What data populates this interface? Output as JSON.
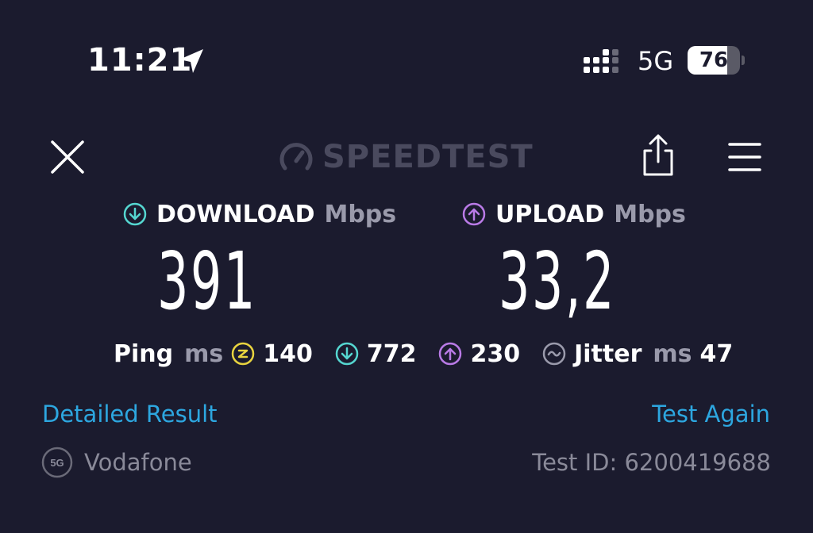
{
  "status_bar": {
    "time": "11:21",
    "network": "5G",
    "battery": {
      "level_text": "76",
      "fraction": 0.76
    }
  },
  "header": {
    "logo_text": "SPEEDTEST"
  },
  "results": {
    "download": {
      "label": "DOWNLOAD",
      "unit": "Mbps",
      "value": "391"
    },
    "upload": {
      "label": "UPLOAD",
      "unit": "Mbps",
      "value": "33,2"
    }
  },
  "ping": {
    "label": "Ping",
    "unit": "ms",
    "idle": "140",
    "download": "772",
    "upload": "230",
    "jitter_label": "Jitter",
    "jitter_unit": "ms",
    "jitter": "47"
  },
  "links": {
    "detailed_result": "Detailed Result",
    "test_again": "Test Again"
  },
  "footer": {
    "carrier_badge": "5G",
    "carrier": "Vodafone",
    "test_id": "Test ID: 6200419688"
  },
  "colors": {
    "background": "#1b1b2e",
    "download_accent": "#55d6d0",
    "upload_accent": "#b97ae6",
    "ping_accent": "#e8d33f",
    "link": "#2da7e0"
  }
}
